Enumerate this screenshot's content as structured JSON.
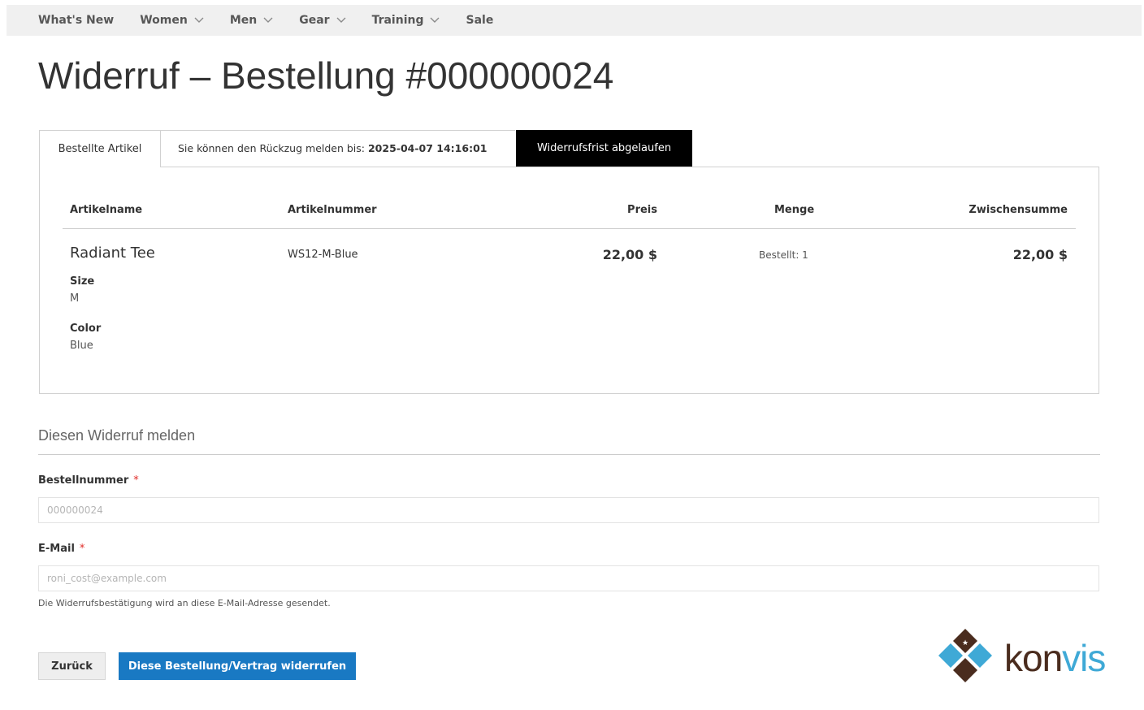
{
  "nav": {
    "items": [
      {
        "label": "What's New",
        "dropdown": false
      },
      {
        "label": "Women",
        "dropdown": true
      },
      {
        "label": "Men",
        "dropdown": true
      },
      {
        "label": "Gear",
        "dropdown": true
      },
      {
        "label": "Training",
        "dropdown": true
      },
      {
        "label": "Sale",
        "dropdown": false
      }
    ]
  },
  "page": {
    "title": "Widerruf – Bestellung #000000024"
  },
  "tabs": {
    "ordered_items": "Bestellte Artikel",
    "deadline_prefix": "Sie können den Rückzug melden bis: ",
    "deadline_value": "2025-04-07 14:16:01",
    "expired_badge": "Widerrufsfrist abgelaufen"
  },
  "table": {
    "headers": {
      "name": "Artikelname",
      "sku": "Artikelnummer",
      "price": "Preis",
      "qty": "Menge",
      "subtotal": "Zwischensumme"
    },
    "rows": [
      {
        "name": "Radiant Tee",
        "sku": "WS12-M-Blue",
        "price": "22,00 $",
        "qty": "Bestellt: 1",
        "subtotal": "22,00 $",
        "options": [
          {
            "label": "Size",
            "value": "M"
          },
          {
            "label": "Color",
            "value": "Blue"
          }
        ]
      }
    ]
  },
  "form": {
    "section_title": "Diesen Widerruf melden",
    "order_label": "Bestellnummer",
    "order_placeholder": "000000024",
    "email_label": "E-Mail",
    "email_placeholder": "roni_cost@example.com",
    "required_mark": "*",
    "note": "Die Widerrufsbestätigung wird an diese E-Mail-Adresse gesendet."
  },
  "buttons": {
    "back": "Zurück",
    "submit": "Diese Bestellung/Vertrag widerrufen"
  },
  "logo": {
    "text_dark": "kon",
    "text_light": "vis"
  },
  "colors": {
    "primary": "#1979c3",
    "badge": "#000000",
    "nav_bg": "#f0f0f0",
    "logo_blue": "#3fa9d6",
    "logo_brown": "#4a2c1e"
  }
}
